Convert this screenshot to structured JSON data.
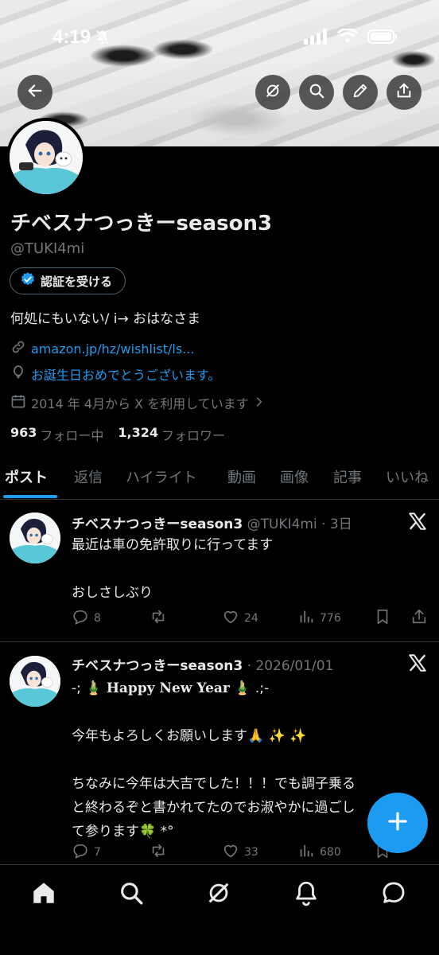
{
  "status_bar": {
    "time": "4:19"
  },
  "profile": {
    "name": "チベスナつっきーseason3",
    "handle": "@TUKI4mi",
    "verify_label": "認証を受ける",
    "bio": "何処にもいない/ i→ おはなさま",
    "link": "amazon.jp/hz/wishlist/ls...",
    "birthday": "お誕生日おめでとうございます。",
    "joined": "2014 年 4月から X を利用しています",
    "following_count": "963",
    "following_label": "フォロー中",
    "followers_count": "1,324",
    "followers_label": "フォロワー"
  },
  "tabs": [
    "ポスト",
    "返信",
    "ハイライト",
    "動画",
    "画像",
    "記事",
    "いいね"
  ],
  "posts": [
    {
      "name": "チベスナつっきーseason3",
      "meta": "@TUKI4mi · 3日",
      "lines": [
        "最近は車の免許取りに行ってます",
        "",
        "おしさしぶり"
      ],
      "replies": "8",
      "reposts": "",
      "likes": "24",
      "views": "776"
    },
    {
      "name": "チベスナつっきーseason3",
      "meta": "· 2026/01/01",
      "line1_left": "-;",
      "line1_emoji_left": "🎍",
      "line1_text": "Happy New Year",
      "line1_emoji_right": "🎍",
      "line1_right": ".;-",
      "lines": [
        "",
        "今年もよろしくお願いします🙏 ✨ ✨",
        "",
        "ちなみに今年は大吉でした！！！でも調子乗る",
        "と終わるぞと書かれてたのでお淑やかに過ごし",
        "て参ります🍀 *°"
      ],
      "replies": "7",
      "reposts": "",
      "likes": "33",
      "views": "680"
    }
  ],
  "colors": {
    "accent": "#1d9bf0",
    "background": "#000000",
    "muted": "#71767b",
    "divider": "#2f3336"
  }
}
